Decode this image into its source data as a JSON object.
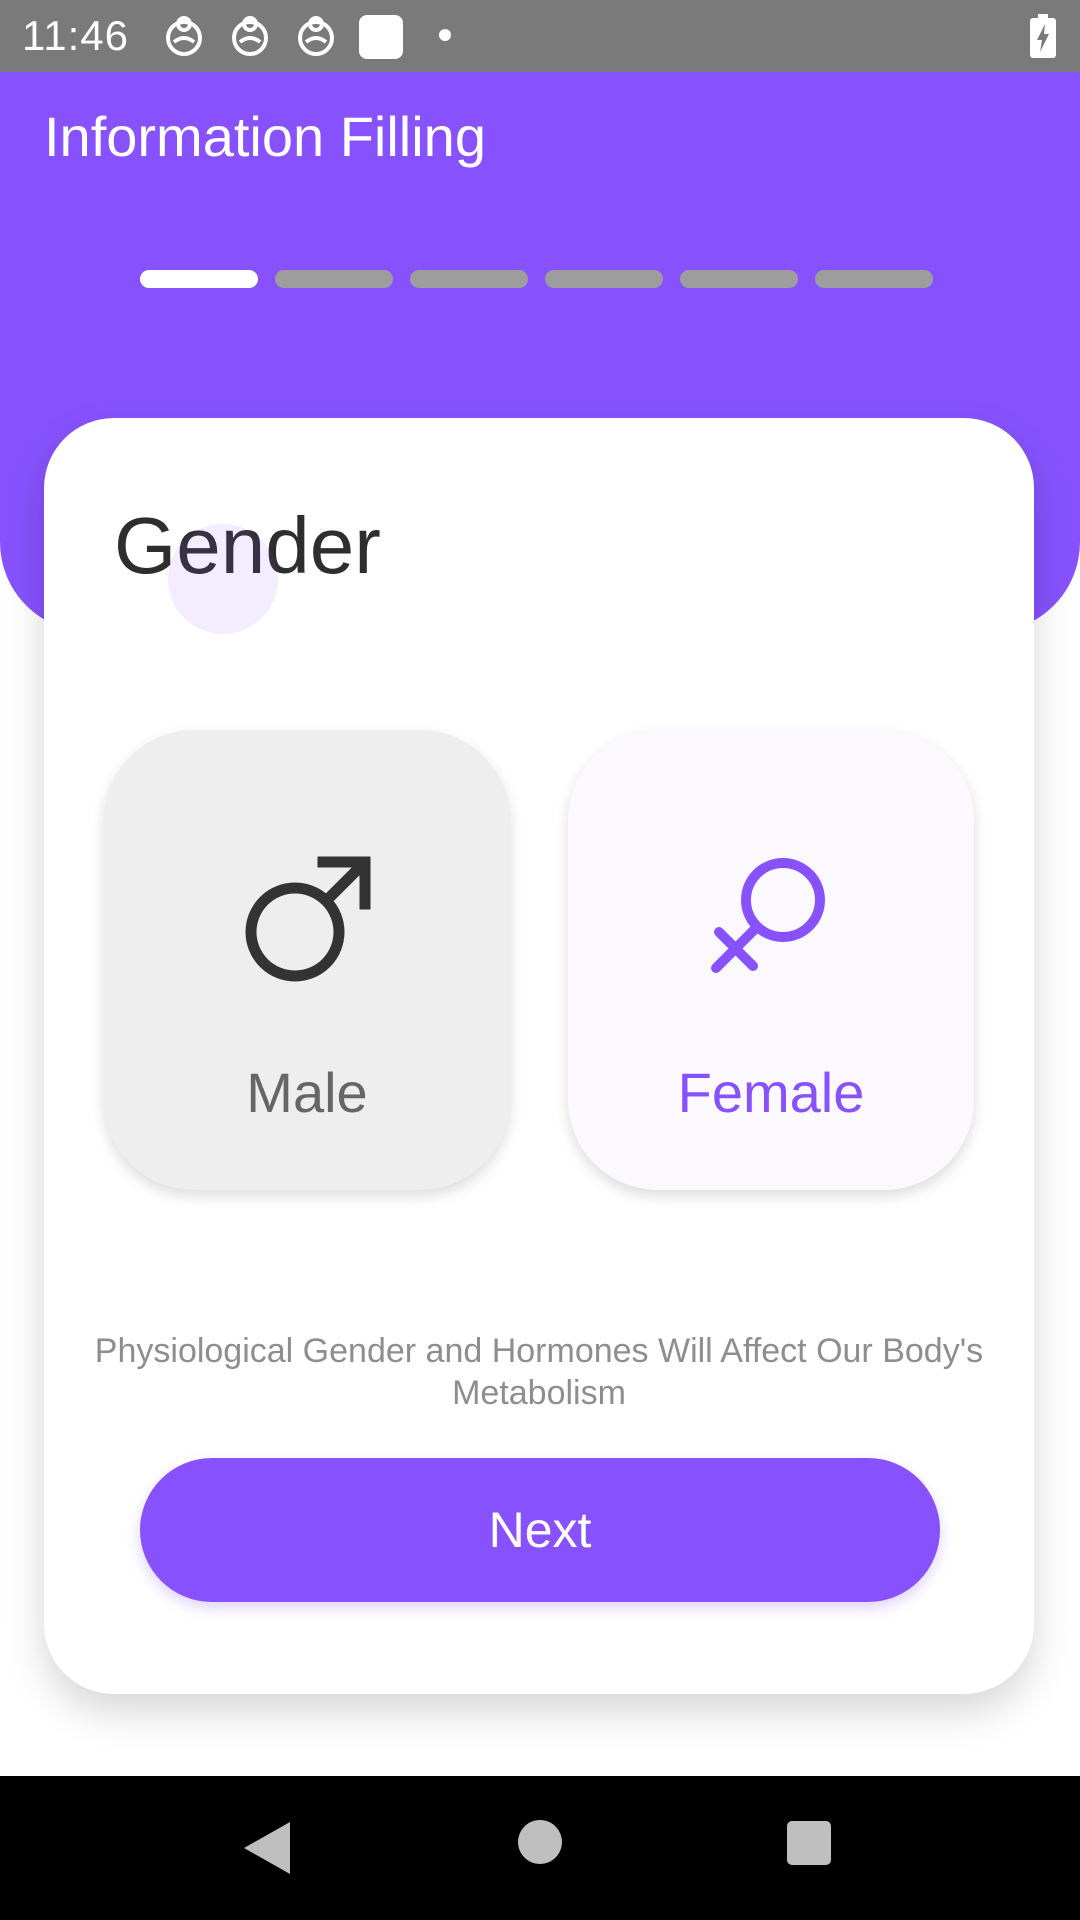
{
  "status_bar": {
    "time": "11:46",
    "icons": [
      "notification-app-icon",
      "notification-app-icon",
      "notification-app-icon",
      "notification-square-icon",
      "notification-dot-icon",
      "battery-charging-icon"
    ]
  },
  "header": {
    "title": "Information Filling",
    "progress": {
      "total_steps": 6,
      "current_step": 1
    }
  },
  "card": {
    "title": "Gender",
    "options": [
      {
        "label": "Male",
        "icon": "male-symbol-icon",
        "color": "#333333"
      },
      {
        "label": "Female",
        "icon": "female-symbol-icon",
        "color": "#8752fe"
      }
    ],
    "hint": "Physiological Gender and Hormones Will Affect Our Body's Metabolism",
    "next_label": "Next"
  },
  "nav_bar": {
    "icons": [
      "back-icon",
      "home-icon",
      "recents-icon"
    ]
  },
  "colors": {
    "accent": "#8752fe",
    "status_bar": "#7a7a7a",
    "inactive_step": "#9d9d9d"
  }
}
